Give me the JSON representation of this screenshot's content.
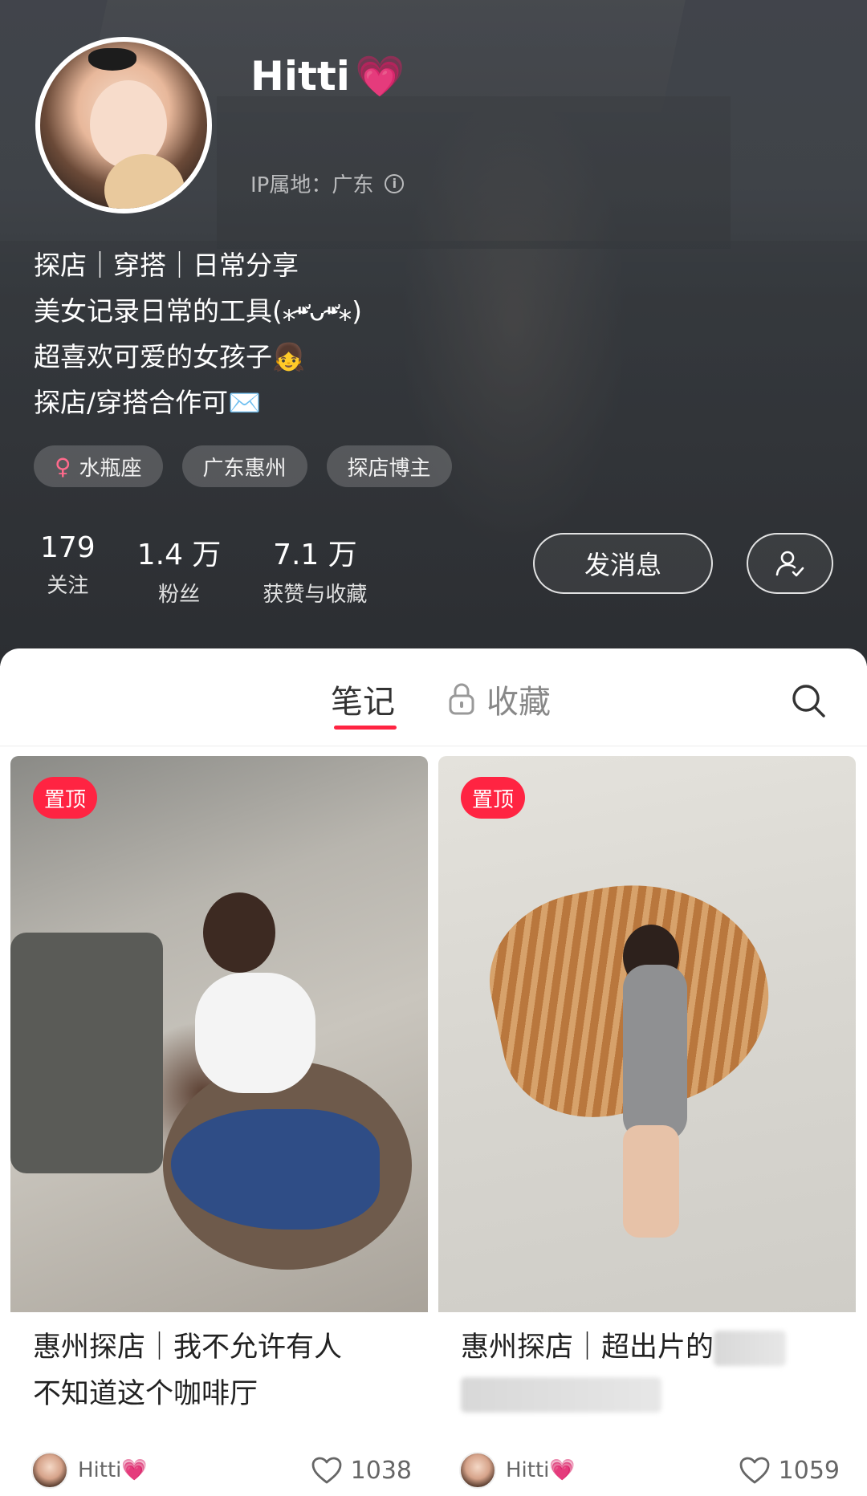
{
  "profile": {
    "nickname": "Hitti",
    "nickname_emoji": "💗",
    "ip_location": "IP属地：广东",
    "bio": [
      "探店｜穿搭｜日常分享",
      "美女记录日常的工具(⁎⁍̴̛ᴗ⁍̴̛⁎)",
      "超喜欢可爱的女孩子👧",
      "探店/穿搭合作可✉️"
    ],
    "tags": [
      {
        "icon": "female-icon",
        "label": "水瓶座"
      },
      {
        "label": "广东惠州"
      },
      {
        "label": "探店博主"
      }
    ],
    "stats": [
      {
        "value": "179",
        "label": "关注"
      },
      {
        "value": "1.4 万",
        "label": "粉丝"
      },
      {
        "value": "7.1 万",
        "label": "获赞与收藏"
      }
    ],
    "message_button": "发消息",
    "follow_icon": "user-check-icon"
  },
  "tabs": {
    "notes": "笔记",
    "collections": "收藏",
    "active": "notes",
    "accent_color": "#ff2442"
  },
  "notes": [
    {
      "pinned_label": "置顶",
      "title_line1": "惠州探店｜我不允许有人",
      "title_line2": "不知道这个咖啡厅",
      "author": "Hitti",
      "author_emoji": "💗",
      "likes": "1038"
    },
    {
      "pinned_label": "置顶",
      "title_line1": "惠州探店｜超出片的",
      "author": "Hitti",
      "author_emoji": "💗",
      "likes": "1059"
    }
  ]
}
